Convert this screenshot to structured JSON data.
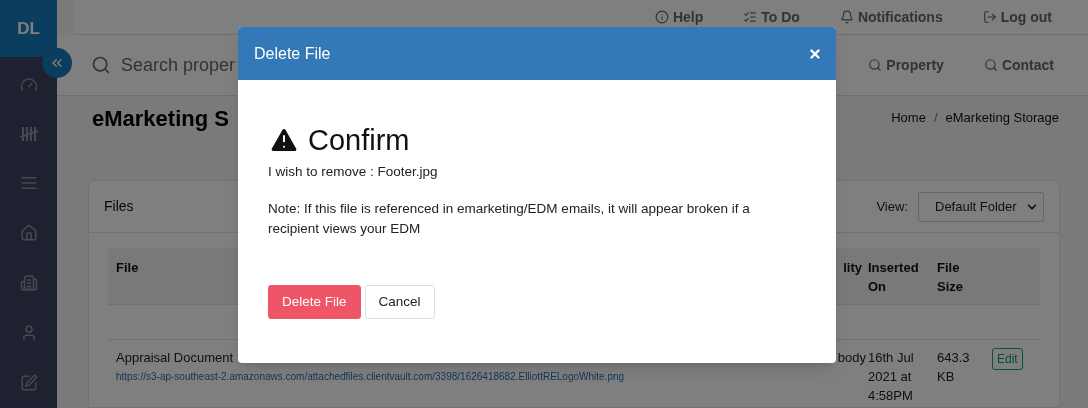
{
  "sidebar": {
    "logo": "DL"
  },
  "top_links": [
    {
      "label": "Help"
    },
    {
      "label": "To Do"
    },
    {
      "label": "Notifications"
    },
    {
      "label": "Log out"
    }
  ],
  "search": {
    "placeholder": "Search proper"
  },
  "quick_search": [
    {
      "label": "Property"
    },
    {
      "label": "Contact"
    }
  ],
  "page_title": "eMarketing S",
  "breadcrumb": {
    "items": [
      "Home",
      "eMarketing Storage"
    ],
    "separator": "/"
  },
  "files_card": {
    "title": "Files",
    "view_label": "View:",
    "view_select": "Default Folder",
    "columns": [
      "File",
      "lity",
      "Inserted On",
      "File Size"
    ],
    "rows": [
      {
        "file": "Appraisal Document",
        "url": "https://s3-ap-southeast-2.amazonaws.com/attachedfiles.clientvault.com/3398/1626418682.ElliottRELogoWhite.png",
        "column_2": "body",
        "inserted": "16th Jul 2021 at 4:58PM",
        "size": "643.3 KB",
        "action": "Edit"
      }
    ]
  },
  "modal": {
    "title": "Delete File",
    "heading": "Confirm",
    "message": "I wish to remove : Footer.jpg",
    "note": "Note: If this file is referenced in emarketing/EDM emails, it will appear broken if a recipient views your EDM",
    "buttons": [
      {
        "label": "Delete File",
        "kind": "danger"
      },
      {
        "label": "Cancel",
        "kind": "default"
      }
    ]
  }
}
